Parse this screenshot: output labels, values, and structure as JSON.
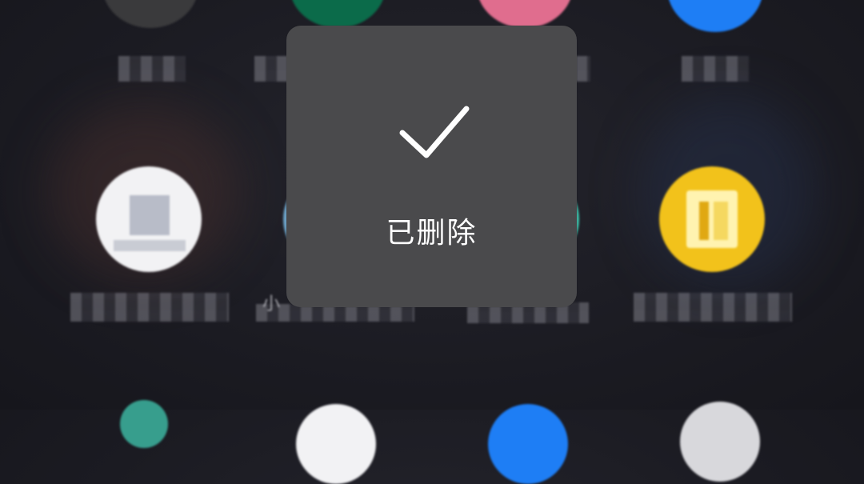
{
  "toast": {
    "message": "已删除",
    "icon": "checkmark-icon"
  },
  "home_screen": {
    "apps": [
      {
        "name": "app-top-1",
        "color": "#3a3a3a"
      },
      {
        "name": "app-top-2",
        "color": "#0b6b4a"
      },
      {
        "name": "app-top-3",
        "color": "#e06d8e"
      },
      {
        "name": "app-top-4",
        "color": "#1e7ef5"
      },
      {
        "name": "app-mid-1",
        "color": "#f4f4f6"
      },
      {
        "name": "app-mid-2",
        "color": "#6da3c8"
      },
      {
        "name": "app-mid-3",
        "color": "#3fbfa9"
      },
      {
        "name": "app-mid-4",
        "color": "#f2c21b"
      }
    ],
    "partial_label": "小"
  }
}
